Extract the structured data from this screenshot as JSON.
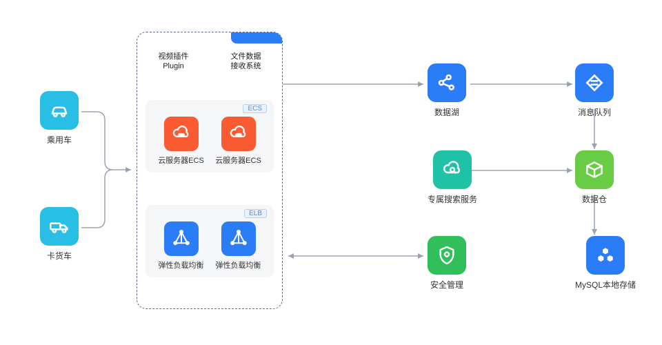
{
  "left": {
    "car": "乘用车",
    "truck": "卡货车"
  },
  "panel": {
    "header_left_line1": "视频插件",
    "header_left_line2": "Plugin",
    "header_right_line1": "文件数据",
    "header_right_line2": "接收系统",
    "ecs_tag": "ECS",
    "ecs_label": "云服务器ECS",
    "elb_tag": "ELB",
    "elb_label": "弹性负载均衡"
  },
  "right": {
    "data_lake": "数据湖",
    "message_queue": "消息队列",
    "search_service": "专属搜索服务",
    "data_warehouse": "数据仓",
    "security_mgmt": "安全管理",
    "mysql": "MySQL本地存储"
  }
}
